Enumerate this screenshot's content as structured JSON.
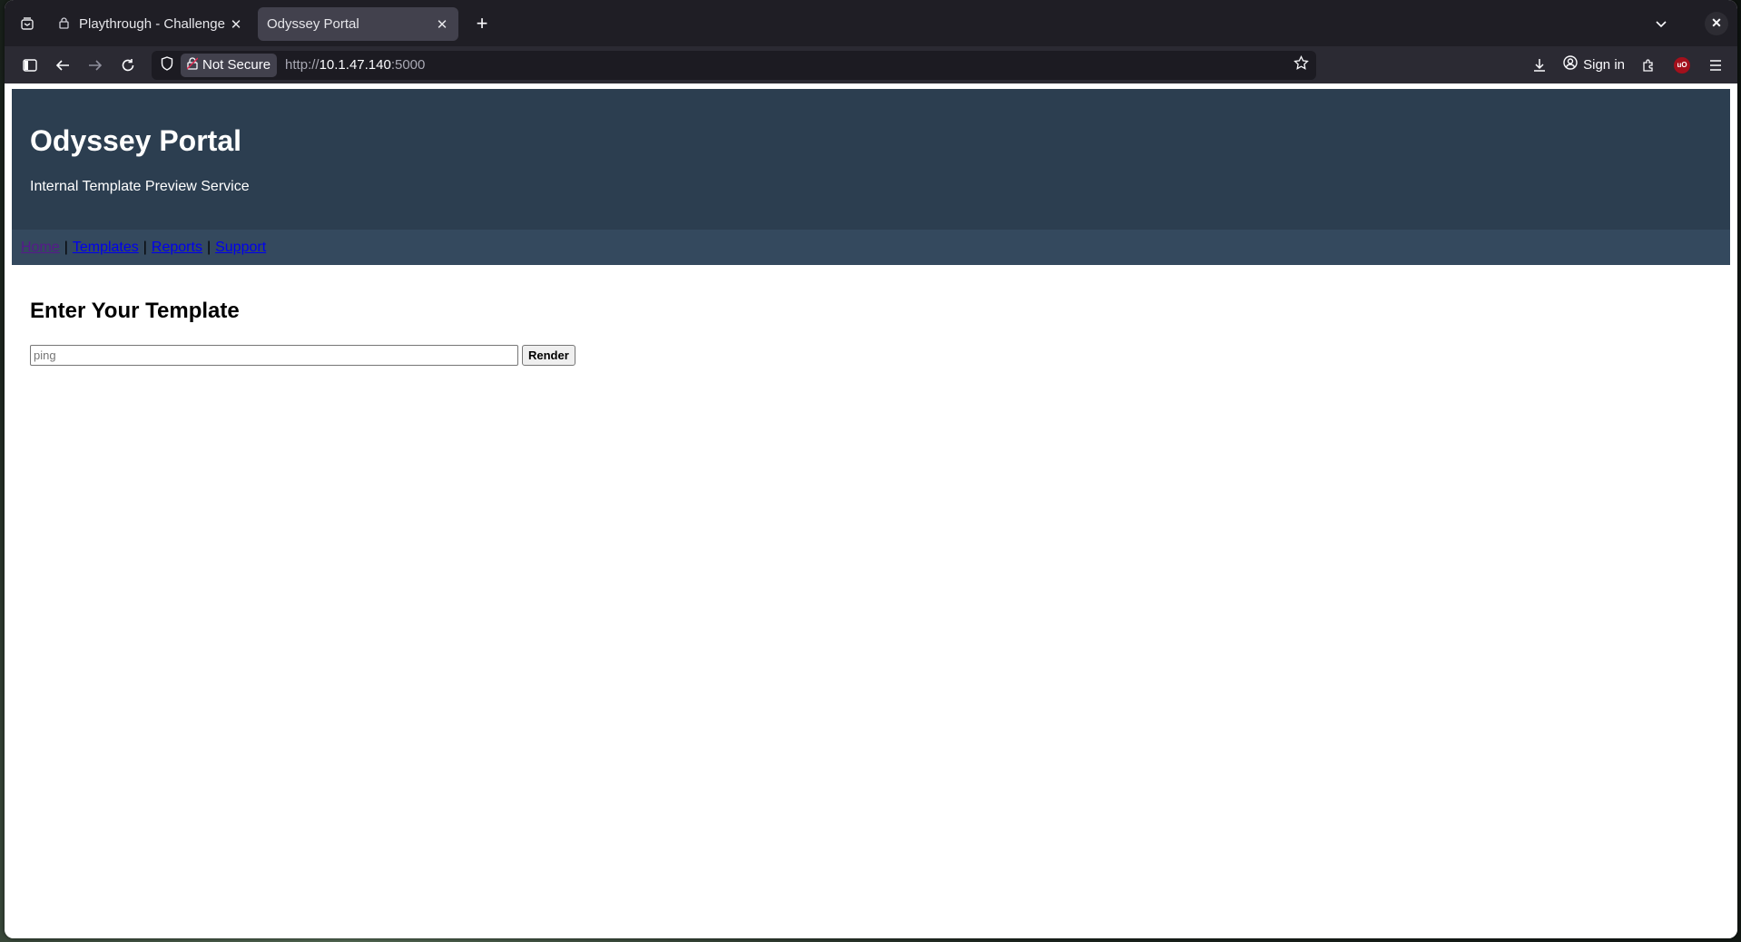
{
  "browser": {
    "tabs": [
      {
        "title": "Playthrough - Challenge L",
        "active": false
      },
      {
        "title": "Odyssey Portal",
        "active": true
      }
    ],
    "tab_close_glyph": "✕",
    "new_tab_glyph": "+",
    "security_label": "Not Secure",
    "url_prefix": "http://",
    "url_host": "10.1.47.140",
    "url_port": ":5000",
    "signin_label": "Sign in",
    "ublock_label": "uO"
  },
  "page": {
    "title": "Odyssey Portal",
    "subtitle": "Internal Template Preview Service",
    "nav": [
      {
        "label": "Home",
        "visited": true
      },
      {
        "label": "Templates",
        "visited": false
      },
      {
        "label": "Reports",
        "visited": false
      },
      {
        "label": "Support",
        "visited": false
      }
    ],
    "nav_separator": "|",
    "form_heading": "Enter Your Template",
    "template_input": {
      "placeholder": "ping",
      "value": ""
    },
    "render_button": "Render"
  },
  "colors": {
    "header_bg": "#2c3e50",
    "nav_bg": "#34495e",
    "link": "#0000ee",
    "visited_link": "#551a8b",
    "browser_chrome": "#2b2a33",
    "tabstrip": "#1f1e25"
  },
  "icons": {
    "tab_list": "tab-list-icon",
    "lock_mini": "lock-icon",
    "tabs_dropdown": "chevron-down-icon",
    "window_close": "close-icon",
    "sidebar": "sidebar-icon",
    "back": "back-arrow-icon",
    "forward": "forward-arrow-icon",
    "reload": "reload-icon",
    "shield": "shield-icon",
    "insecure_lock": "insecure-lock-icon",
    "bookmark": "star-icon",
    "downloads": "download-icon",
    "account": "account-icon",
    "extensions": "puzzle-icon",
    "menu": "hamburger-menu-icon"
  }
}
